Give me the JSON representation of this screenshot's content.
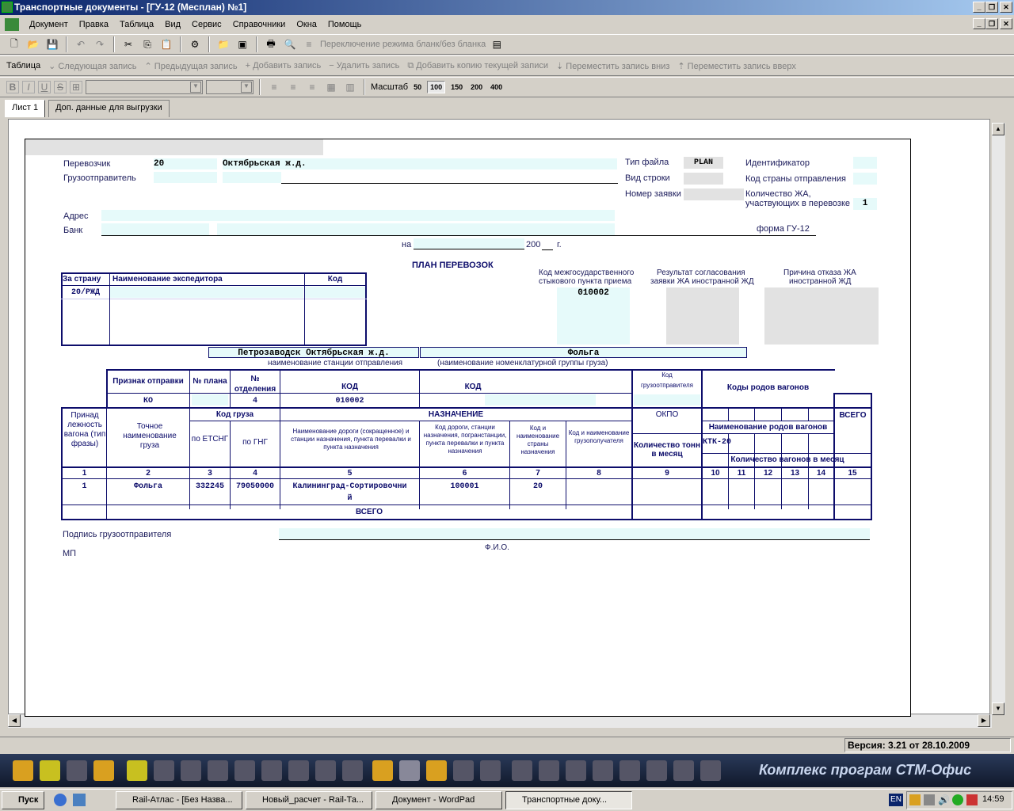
{
  "window": {
    "title": "Транспортные документы - [ГУ-12 (Месплан) №1]"
  },
  "menu": [
    "Документ",
    "Правка",
    "Таблица",
    "Вид",
    "Сервис",
    "Справочники",
    "Окна",
    "Помощь"
  ],
  "toolbar1": {
    "mode_label": "Переключение режима бланк/без бланка"
  },
  "toolbar2": {
    "table": "Таблица",
    "next": "Следующая запись",
    "prev": "Предыдущая запись",
    "add": "Добавить запись",
    "del": "Удалить запись",
    "copy": "Добавить копию текущей записи",
    "down": "Переместить запись вниз",
    "up": "Переместить запись вверх"
  },
  "toolbar3": {
    "scale_label": "Масштаб",
    "scales": [
      "50",
      "100",
      "150",
      "200",
      "400"
    ],
    "font_buttons": [
      "B",
      "I",
      "U",
      "S"
    ]
  },
  "tabs": [
    "Лист 1",
    "Доп. данные для выгрузки"
  ],
  "form": {
    "carrier_label": "Перевозчик",
    "carrier_code": "20",
    "carrier_name": "Октябрьская ж.д.",
    "shipper_label": "Грузоотправитель",
    "filetype_label": "Тип файла",
    "filetype_value": "PLAN",
    "rowtype_label": "Вид строки",
    "order_label": "Номер заявки",
    "identifier_label": "Идентификатор",
    "country_label": "Код страны отправления",
    "count_label_1": "Количество ЖА,",
    "count_label_2": "участвующих в перевозке",
    "count_value": "1",
    "address_label": "Адрес",
    "bank_label": "Банк",
    "form_label": "форма  ГУ-12",
    "on_label": "на",
    "year_label": "200",
    "g_label": "г.",
    "plan_title": "ПЛАН ПЕРЕВОЗОК",
    "exp_country": "За страну",
    "exp_name": "Наименование экспедитора",
    "exp_code": "Код",
    "exp_value": "20/РЖД",
    "border_code_label_1": "Код межгосударственного",
    "border_code_label_2": "стыкового пункта приема",
    "border_code_value": "010002",
    "result_label_1": "Результат согласования",
    "result_label_2": "заявки ЖА иностранной ЖД",
    "reason_label_1": "Причина отказа ЖА",
    "reason_label_2": "иностранной ЖД",
    "station_value": "Петрозаводск Октябрьская ж.д.",
    "station_caption": "наименование станции отправления",
    "cargo_group_value": "Фольга",
    "cargo_group_caption": "(наименование номенклатурной группы груза)"
  },
  "table": {
    "h_sign": "Признак отправки",
    "h_plan": "№ плана",
    "h_dept_1": "№",
    "h_dept_2": "отделения",
    "h_code": "КОД",
    "h_code2": "КОД",
    "h_shipper_code_1": "Код",
    "h_shipper_code_2": "грузоотправителя",
    "h_wagon_codes": "Коды родов вагонов",
    "h_total": "ВСЕГО",
    "sign_value": "КО",
    "dept_value": "4",
    "code_value": "010002",
    "h_belong": "Принад лежность вагона (тип фразы)",
    "h_cargo_name": "Точное наименование груза",
    "h_cargo_code": "Код груза",
    "h_etsng": "по ЕТСНГ",
    "h_gng": "по ГНГ",
    "h_dest": "НАЗНАЧЕНИЕ",
    "h_road": "Наименование дороги (сокращенное) и станции назначения, пункта перевалки и пункта назначения",
    "h_road_code": "Код дороги, станции назначения, погранстанции, пункта перевалки и пункта назначения",
    "h_country": "Код и наименование страны назначения",
    "h_consignee": "Код и наименование грузополучателя",
    "h_okpo": "ОКПО",
    "h_tons": "Количество тонн в месяц",
    "h_wagon_names": "Наименование родов вагонов",
    "h_wagon_count": "Количество вагонов в месяц",
    "ktk": "КТК-20",
    "cols": [
      "1",
      "2",
      "3",
      "4",
      "5",
      "6",
      "7",
      "8",
      "9",
      "10",
      "11",
      "12",
      "13",
      "14",
      "15"
    ],
    "row": {
      "n": "1",
      "cargo": "Фольга",
      "etsng": "332245",
      "gng": "79050000",
      "dest": "Калининград-Сортировочни",
      "dest2": "й",
      "road_code": "100001",
      "country": "20"
    },
    "total": "ВСЕГО"
  },
  "footer": {
    "sign_label": "Подпись грузоотправителя",
    "fio": "Ф.И.О.",
    "mp": "МП"
  },
  "status": {
    "version": "Версия: 3.21 от 28.10.2009"
  },
  "panel": {
    "brand": "Комплекс програм СТМ-Офис"
  },
  "taskbar": {
    "start": "Пуск",
    "tasks": [
      "Rail-Атлас - [Без Назва...",
      "Новый_расчет - Rail-Та...",
      "Документ - WordPad",
      "Транспортные доку..."
    ],
    "lang": "EN",
    "time": "14:59"
  }
}
